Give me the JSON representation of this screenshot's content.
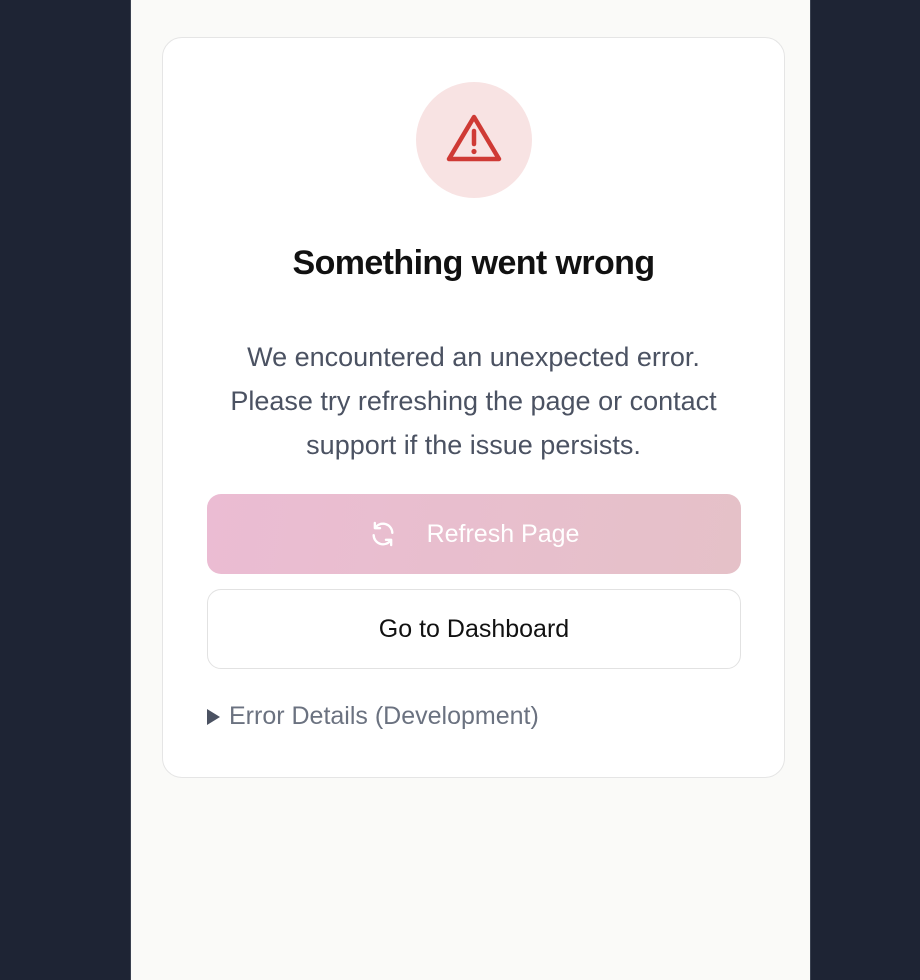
{
  "error_card": {
    "title": "Something went wrong",
    "message": "We encountered an unexpected error. Please try refreshing the page or contact support if the issue persists.",
    "icon": "warning-triangle-icon"
  },
  "actions": {
    "refresh_label": "Refresh Page",
    "refresh_icon": "refresh-icon",
    "dashboard_label": "Go to Dashboard"
  },
  "details": {
    "summary_label": "Error Details (Development)"
  },
  "colors": {
    "background": "#1e2434",
    "page": "#fafaf8",
    "danger": "#cf3a35",
    "danger_tint": "#f8e3e3",
    "refresh_gradient_start": "#ebbcd3",
    "refresh_gradient_end": "#e5c1c8"
  }
}
